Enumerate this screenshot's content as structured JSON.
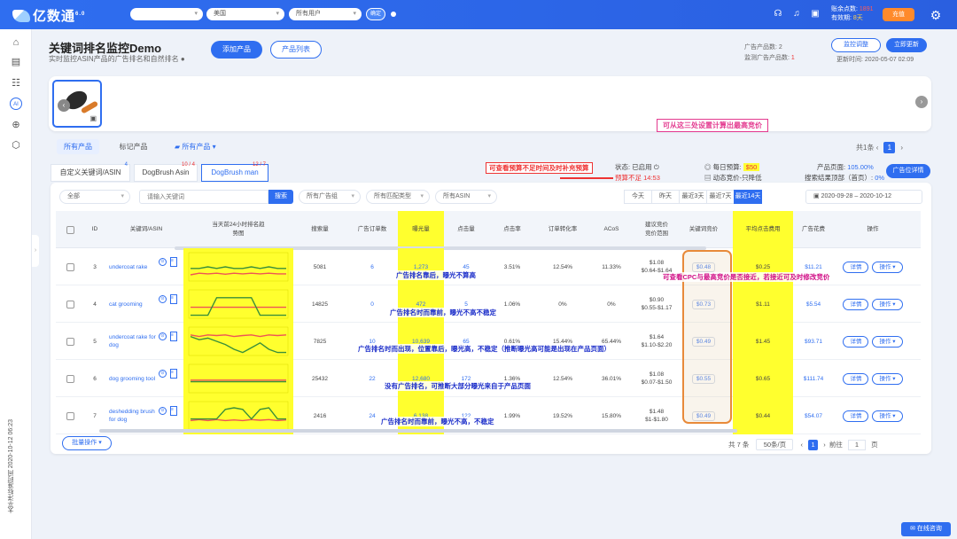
{
  "topbar": {
    "logo": "亿数通",
    "logo_version": "6.0",
    "select_shop": "",
    "select_region": "美国",
    "select_user": "所有用户",
    "confirm": "确定",
    "balance_label": "账余点数:",
    "balance_value": "1891",
    "status_label": "有效期:",
    "status_value": "8天",
    "recharge": "充值"
  },
  "header": {
    "title": "关键词排名监控Demo",
    "subtitle": "实时监控ASIN产品的广告排名和自然排名",
    "add_product": "添加产品",
    "product_list": "产品列表",
    "ad_product_count_label": "广告产品数:",
    "ad_product_count": "2",
    "monitor_count_label": "监测广告产品数:",
    "monitor_count": "1",
    "monitor_adjust": "监控调整",
    "update_now": "立即更新",
    "update_time_label": "更新时间:",
    "update_time": "2020-05-07 02:09"
  },
  "annotations": {
    "top": "可从这三处设置计算出最高竞价",
    "budget": "可查看预算不足时间及时补充预算",
    "cpc": "可查看CPC与最高竞价是否接近，若接近可及时修改竞价",
    "row1": "广告排名靠后，曝光不算高",
    "row2": "广告排名时而靠前，曝光不高不稳定",
    "row3": "广告排名时而出现，位置靠后，曝光高，不稳定（推断曝光高可能是出现在产品页面）",
    "row4": "没有广告排名，可推断大部分曝光来自于产品页面",
    "row5": "广告排名时而靠前，曝光不高，不稳定"
  },
  "tabs1": [
    "所有产品",
    "标记产品",
    "所有产品"
  ],
  "pager_top": {
    "total": "共1条",
    "page": "1"
  },
  "tabs2": [
    {
      "label": "自定义关键词/ASIN",
      "count": "4"
    },
    {
      "label": "DogBrush Asin",
      "count": "10 / 4"
    },
    {
      "label": "DogBrush man",
      "count": "12 / 7"
    }
  ],
  "status": {
    "state_label": "状态:",
    "state_value": "已启用",
    "budget_short_label": "预算不足",
    "budget_short_value": "14:53",
    "daily_budget_label": "每日预算:",
    "daily_budget": "$50",
    "strategy": "动态竞价-只降低",
    "product_page_label": "产品页面:",
    "product_page_value": "105.00%",
    "search_top_label": "搜索结果顶部（首页）:",
    "search_top_value": "0%",
    "detail_button": "广告位详情"
  },
  "filters": {
    "all": "全部",
    "search_placeholder": "请输入关键词",
    "search": "搜索",
    "ad_group": "所有广告组",
    "match_type": "所有匹配类型",
    "asin": "所有ASIN",
    "date_buttons": [
      "今天",
      "昨天",
      "最近3天",
      "最近7天",
      "最近14天"
    ],
    "date_active": 4,
    "date_start": "2020-09-28",
    "date_end": "2020-10-12"
  },
  "columns": [
    "ID",
    "关键词/ASIN",
    "当天前24小时排名趋势图",
    "搜索量",
    "广告订单数",
    "曝光量",
    "点击量",
    "点击率",
    "订单转化率",
    "ACoS",
    "建议竞价竞价范围",
    "关键词竞价",
    "平均点击费用",
    "广告花费",
    "操作"
  ],
  "rows": [
    {
      "id": "3",
      "kw": "undercoat rake",
      "search": "5081",
      "orders": "6",
      "impr": "1,273",
      "clicks": "45",
      "ctr": "3.51%",
      "cvr": "12.54%",
      "acos": "11.33%",
      "bid1": "$1.08",
      "bid2": "$0.64-$1.64",
      "kwbid": "$0.48",
      "cpc": "$0.25",
      "spend": "$11.21"
    },
    {
      "id": "4",
      "kw": "cat grooming",
      "search": "14825",
      "orders": "0",
      "impr": "472",
      "clicks": "5",
      "ctr": "1.06%",
      "cvr": "0%",
      "acos": "0%",
      "bid1": "$0.90",
      "bid2": "$0.55-$1.17",
      "kwbid": "$0.73",
      "cpc": "$1.11",
      "spend": "$5.54"
    },
    {
      "id": "5",
      "kw": "undercoat rake for dog",
      "search": "7825",
      "orders": "10",
      "impr": "10,639",
      "clicks": "65",
      "ctr": "0.61%",
      "cvr": "15.44%",
      "acos": "65.44%",
      "bid1": "$1.64",
      "bid2": "$1.10-$2.20",
      "kwbid": "$0.49",
      "cpc": "$1.45",
      "spend": "$93.71"
    },
    {
      "id": "6",
      "kw": "dog grooming tool",
      "search": "25432",
      "orders": "22",
      "impr": "12,680",
      "clicks": "172",
      "ctr": "1.36%",
      "cvr": "12.54%",
      "acos": "36.01%",
      "bid1": "$1.08",
      "bid2": "$0.07-$1.50",
      "kwbid": "$0.55",
      "cpc": "$0.65",
      "spend": "$111.74"
    },
    {
      "id": "7",
      "kw": "deshedding brush for dog",
      "search": "2416",
      "orders": "24",
      "impr": "6,138",
      "clicks": "122",
      "ctr": "1.99%",
      "cvr": "19.52%",
      "acos": "15.80%",
      "bid1": "$1.48",
      "bid2": "$1-$1.80",
      "kwbid": "$0.49",
      "cpc": "$0.44",
      "spend": "$54.07"
    }
  ],
  "row_actions": {
    "detail": "详情",
    "ops": "操作"
  },
  "footer": {
    "bulk": "批量操作",
    "total": "共 7 条",
    "page_size": "50条/页",
    "page": "1",
    "goto": "前往",
    "goto_value": "1",
    "page_unit": "页"
  },
  "side_time": "太平洋标准时间 2020-10-12 06:23",
  "chat": "在线咨询"
}
